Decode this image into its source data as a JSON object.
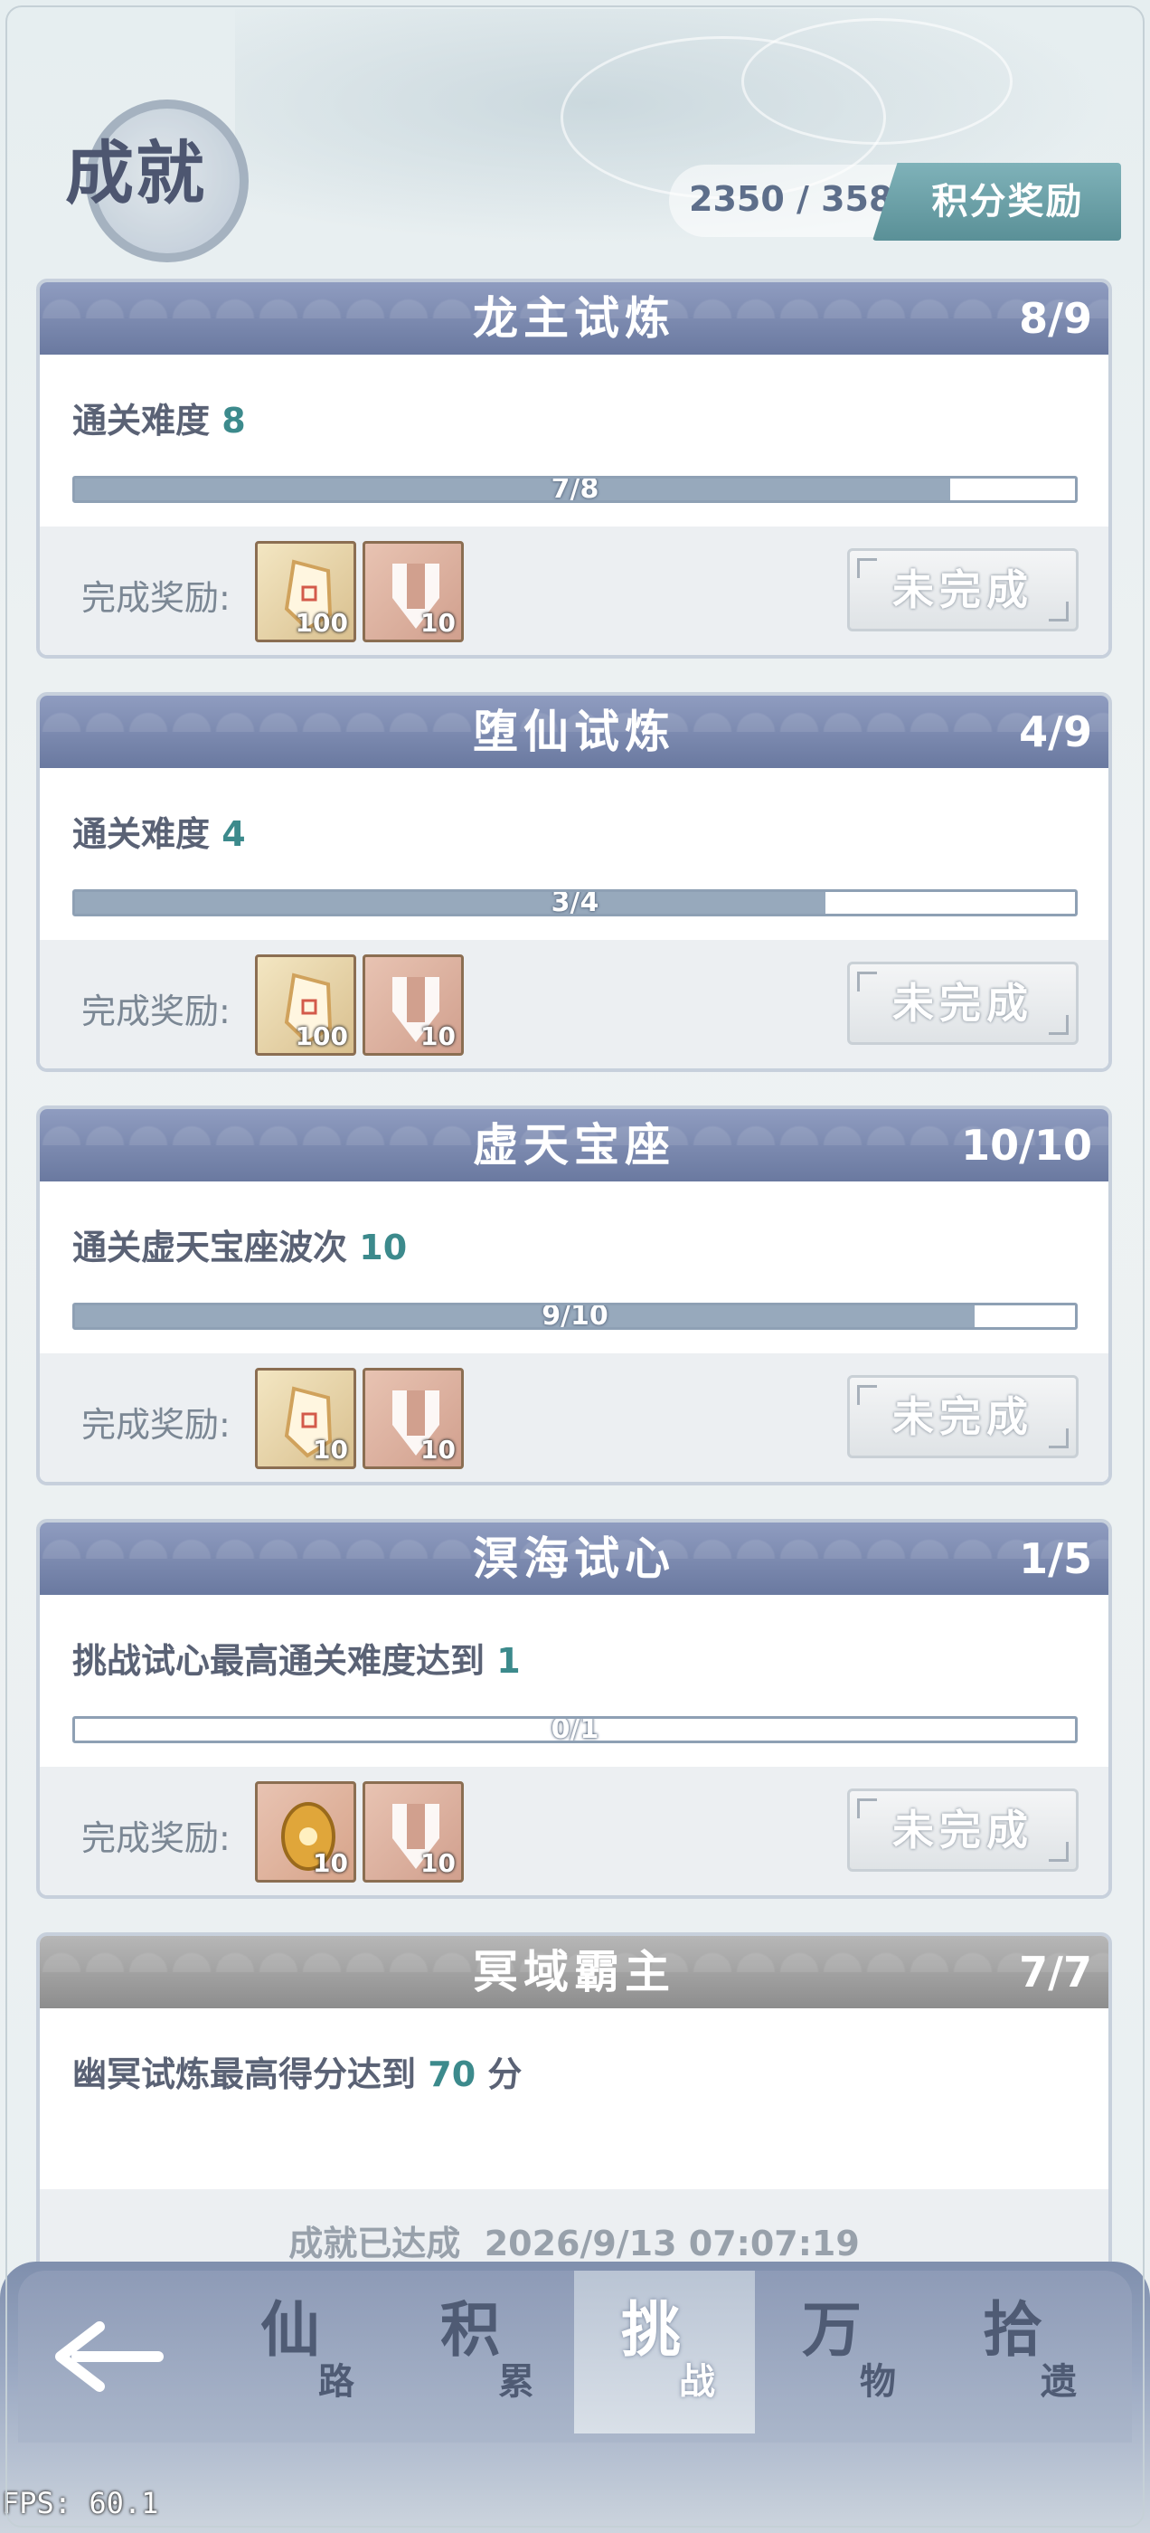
{
  "header": {
    "title": "成就",
    "score": "2350 / 3580",
    "reward_button": "积分奖励"
  },
  "cards": [
    {
      "title": "龙主试炼",
      "count": "8/9",
      "goal_text": "通关难度",
      "goal_num": "8",
      "progress_text": "7/8",
      "progress": 0.875,
      "reward_label": "完成奖励:",
      "items": [
        {
          "icon": "gem-shard-icon",
          "qty": "100"
        },
        {
          "icon": "armor-chest-icon",
          "qty": "10"
        }
      ],
      "status": "未完成"
    },
    {
      "title": "堕仙试炼",
      "count": "4/9",
      "goal_text": "通关难度",
      "goal_num": "4",
      "progress_text": "3/4",
      "progress": 0.75,
      "reward_label": "完成奖励:",
      "items": [
        {
          "icon": "gem-shard-icon",
          "qty": "100"
        },
        {
          "icon": "armor-chest-icon",
          "qty": "10"
        }
      ],
      "status": "未完成"
    },
    {
      "title": "虚天宝座",
      "count": "10/10",
      "goal_text": "通关虚天宝座波次",
      "goal_num": "10",
      "progress_text": "9/10",
      "progress": 0.9,
      "reward_label": "完成奖励:",
      "items": [
        {
          "icon": "gem-shard-icon",
          "qty": "10"
        },
        {
          "icon": "armor-chest-icon",
          "qty": "10"
        }
      ],
      "status": "未完成"
    },
    {
      "title": "溟海试心",
      "count": "1/5",
      "goal_text": "挑战试心最高通关难度达到",
      "goal_num": "1",
      "progress_text": "0/1",
      "progress": 0.0,
      "reward_label": "完成奖励:",
      "items": [
        {
          "icon": "golden-relic-icon",
          "qty": "10"
        },
        {
          "icon": "armor-chest-icon",
          "qty": "10"
        }
      ],
      "status": "未完成"
    }
  ],
  "completed_card": {
    "title": "冥域霸主",
    "count": "7/7",
    "goal_text": "幽冥试炼最高得分达到",
    "goal_num": "70",
    "goal_unit": "分",
    "achieved_text": "成就已达成",
    "achieved_time": "2026/9/13 07:07:19"
  },
  "nav": {
    "tabs": [
      {
        "big": "仙",
        "small": "路"
      },
      {
        "big": "积",
        "small": "累"
      },
      {
        "big": "挑",
        "small": "战",
        "active": true
      },
      {
        "big": "万",
        "small": "物"
      },
      {
        "big": "拾",
        "small": "遗"
      }
    ]
  },
  "fps": "FPS: 60.1",
  "colors": {
    "card_header": "#6a79a0",
    "done_header": "#8d8d8d",
    "accent_num": "#3c8a8c",
    "reward_button": "#5a9097"
  }
}
